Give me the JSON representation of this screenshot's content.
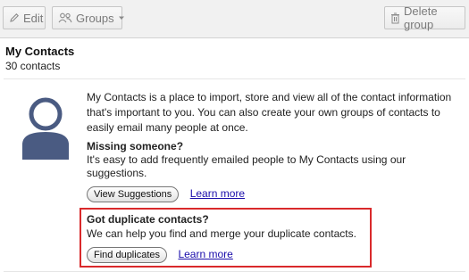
{
  "toolbar": {
    "edit_label": "Edit",
    "groups_label": "Groups",
    "delete_group_label": "Delete group"
  },
  "header": {
    "title": "My Contacts",
    "count": "30 contacts"
  },
  "info": {
    "intro": "My Contacts is a place to import, store and view all of the contact information that's important to you. You can also create your own groups of contacts to easily email many people at once.",
    "missing_title": "Missing someone?",
    "missing_text": "It's easy to add frequently emailed people to My Contacts using our suggestions.",
    "view_suggestions_label": "View Suggestions",
    "learn_more_1": "Learn more",
    "duplicates_title": "Got duplicate contacts?",
    "duplicates_text": "We can help you find and merge your duplicate contacts.",
    "find_duplicates_label": "Find duplicates",
    "learn_more_2": "Learn more"
  },
  "colors": {
    "avatar": "#4a5b82",
    "highlight_box": "#d9292b",
    "link": "#1a0dab"
  }
}
